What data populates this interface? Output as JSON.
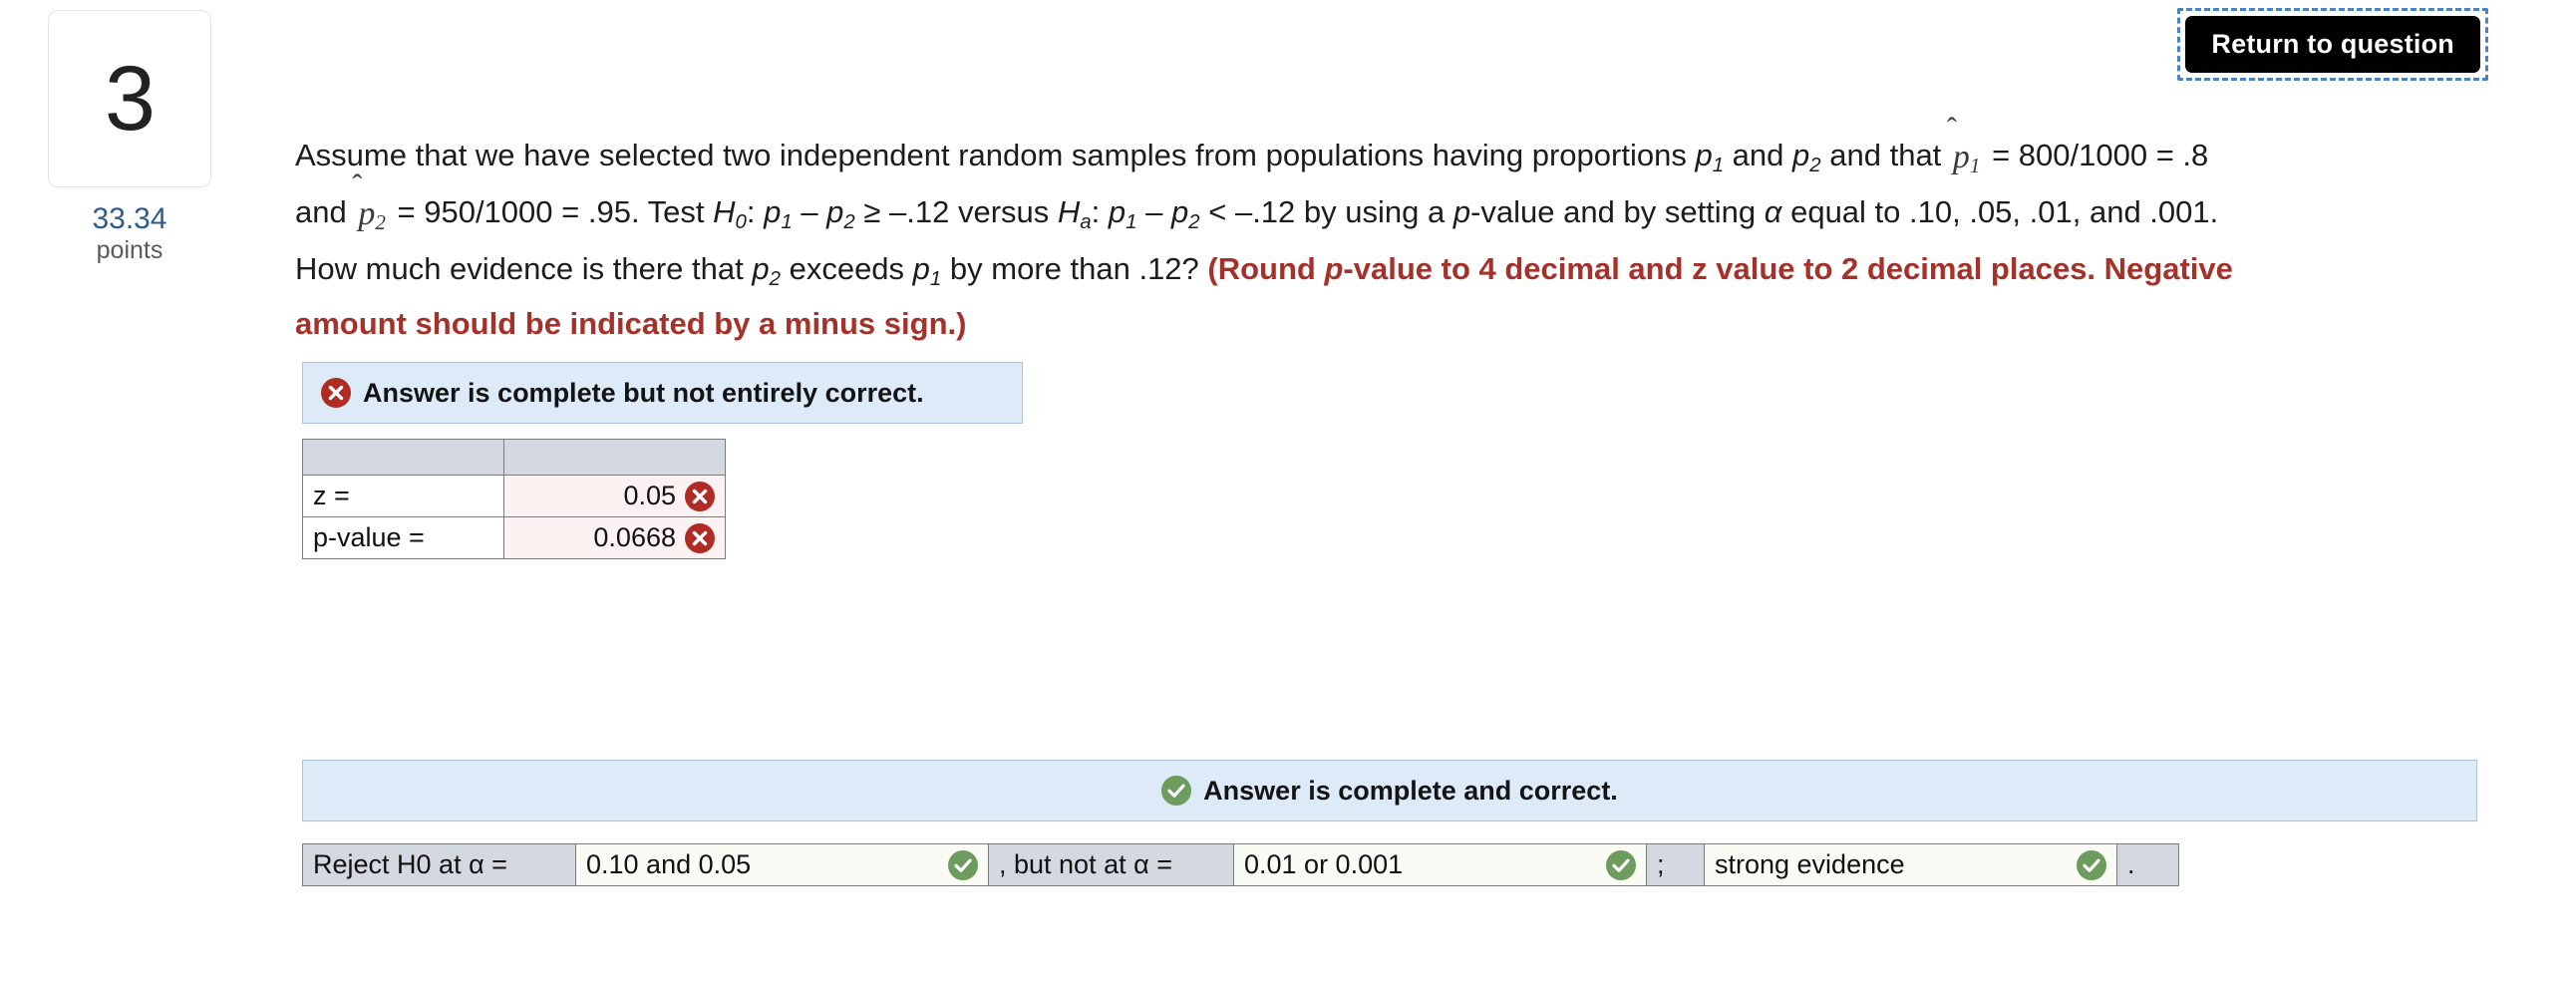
{
  "question": {
    "number": "3",
    "points_value": "33.34",
    "points_label": "points",
    "text_parts": {
      "s1": "Assume that we have selected two independent random samples from populations having proportions ",
      "p1a": "p",
      "sub1a": "1",
      "s2": " and ",
      "p1b": "p",
      "sub1b": "2",
      "s3": " and that ",
      "phat1": "p",
      "phat1sub": "1",
      "s4": " = 800/1000 = .8 and ",
      "phat2": "p",
      "phat2sub": "2",
      "s5": " = 950/1000 = .95. Test ",
      "H0": "H",
      "H0sub": "0",
      "s6": ": ",
      "p2a": "p",
      "sub2a": "1",
      "s7": " – ",
      "p2b": "p",
      "sub2b": "2",
      "s8": " ≥ –.12 versus ",
      "Ha": "H",
      "Hasub": "a",
      "s9": ": ",
      "p3a": "p",
      "sub3a": "1",
      "s10": " – ",
      "p3b": "p",
      "sub3b": "2",
      "s11": " < –.12 by using a ",
      "pv": "p",
      "s12": "-value and by setting ",
      "alpha": "α",
      "s13": " equal to .10, .05, .01, and .001. How much evidence is there that ",
      "p4a": "p",
      "sub4a": "2",
      "s14": " exceeds ",
      "p4b": "p",
      "sub4b": "1",
      "s15": " by more than .12? ",
      "red_a": "(Round ",
      "red_p": "p",
      "red_b": "-value to 4 decimal and z value to 2 decimal places. Negative amount should be indicated by a minus sign.)"
    }
  },
  "toolbar": {
    "return_label": "Return to question"
  },
  "result_incorrect": {
    "banner_text": "Answer is complete but not entirely correct.",
    "icon": "x-circle-icon",
    "rows": [
      {
        "label": "z =",
        "value": "0.05",
        "status": "incorrect"
      },
      {
        "label": "p-value =",
        "value": "0.0668",
        "status": "incorrect"
      }
    ]
  },
  "result_correct": {
    "banner_text": "Answer is complete and correct.",
    "icon": "check-circle-icon",
    "cells": [
      {
        "type": "label",
        "text": "Reject H0 at α ="
      },
      {
        "type": "answer",
        "text": "0.10 and 0.05",
        "status": "correct"
      },
      {
        "type": "label",
        "text": ", but not at α ="
      },
      {
        "type": "answer",
        "text": "0.01 or 0.001",
        "status": "correct"
      },
      {
        "type": "label",
        "text": ";"
      },
      {
        "type": "answer",
        "text": "strong evidence",
        "status": "correct"
      },
      {
        "type": "label",
        "text": "."
      }
    ]
  },
  "colors": {
    "accent_blue": "#2d5b8e",
    "warning_red": "#a5322a",
    "icon_red": "#b02b23",
    "icon_green": "#6e9c5e",
    "banner_bg": "#ddeaf8",
    "banner_border": "#a8c4e0",
    "table_header_gray": "#d4d9e1"
  }
}
